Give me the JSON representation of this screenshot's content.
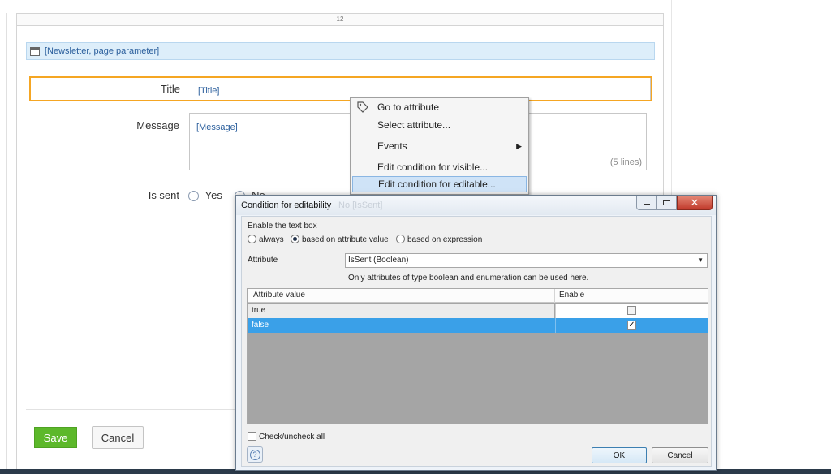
{
  "canvas": {
    "column_ruler": "12",
    "dataview_header": "[Newsletter, page parameter]"
  },
  "form": {
    "title_label": "Title",
    "title_value": "[Title]",
    "message_label": "Message",
    "message_value": "[Message]",
    "message_lines": "(5 lines)",
    "is_sent_label": "Is sent",
    "yes_label": "Yes",
    "no_label": "No",
    "is_sent_attr": "[IsSent]",
    "save_label": "Save",
    "cancel_label": "Cancel"
  },
  "context_menu": {
    "items": [
      {
        "label": "Go to attribute",
        "icon": "tag-icon"
      },
      {
        "label": "Select attribute..."
      },
      {
        "label": "Events",
        "submenu": true
      },
      {
        "label": "Edit condition for visible..."
      },
      {
        "label": "Edit condition for editable..."
      }
    ]
  },
  "dialog": {
    "title": "Condition for editability",
    "ghost_title": "No  [IsSent]",
    "enable_label": "Enable the text box",
    "options": [
      "always",
      "based on attribute value",
      "based on expression"
    ],
    "selected_option": "based on attribute value",
    "attribute_label": "Attribute",
    "attribute_value": "IsSent (Boolean)",
    "hint": "Only attributes of type boolean and enumeration can be used here.",
    "table": {
      "headers": [
        "Attribute value",
        "Enable"
      ],
      "rows": [
        {
          "value": "true",
          "enabled": false
        },
        {
          "value": "false",
          "enabled": true
        }
      ]
    },
    "check_all_label": "Check/uncheck all",
    "ok_label": "OK",
    "cancel_label": "Cancel",
    "colors": {
      "selected_row": "#3aa0e8",
      "close_button": "#c0392b",
      "save_button": "#5cb82a",
      "focus_border": "#f5a623"
    }
  }
}
